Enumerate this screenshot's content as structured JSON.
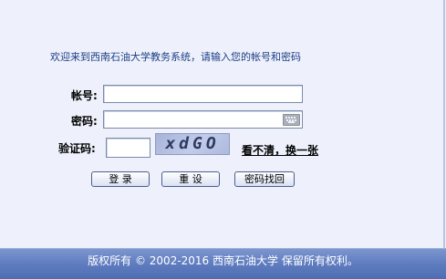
{
  "welcome_text": "欢迎来到西南石油大学教务系统，请输入您的帐号和密码",
  "form": {
    "account_label": "帐号:",
    "account_value": "",
    "password_label": "密码:",
    "password_value": "",
    "captcha_label": "验证码:",
    "captcha_value": "",
    "captcha_text": "xdGO",
    "refresh_captcha_link": "看不清，换一张"
  },
  "buttons": {
    "login": "登 录",
    "reset": "重 设",
    "recover": "密码找回"
  },
  "footer": {
    "copyright": "版权所有 © 2002-2016 西南石油大学 保留所有权利。"
  },
  "icons": {
    "keyboard": "keyboard-icon"
  },
  "colors": {
    "background": "#eef1fb",
    "welcome_text": "#1c3f86",
    "footer_bar": "#5f7cbf"
  }
}
